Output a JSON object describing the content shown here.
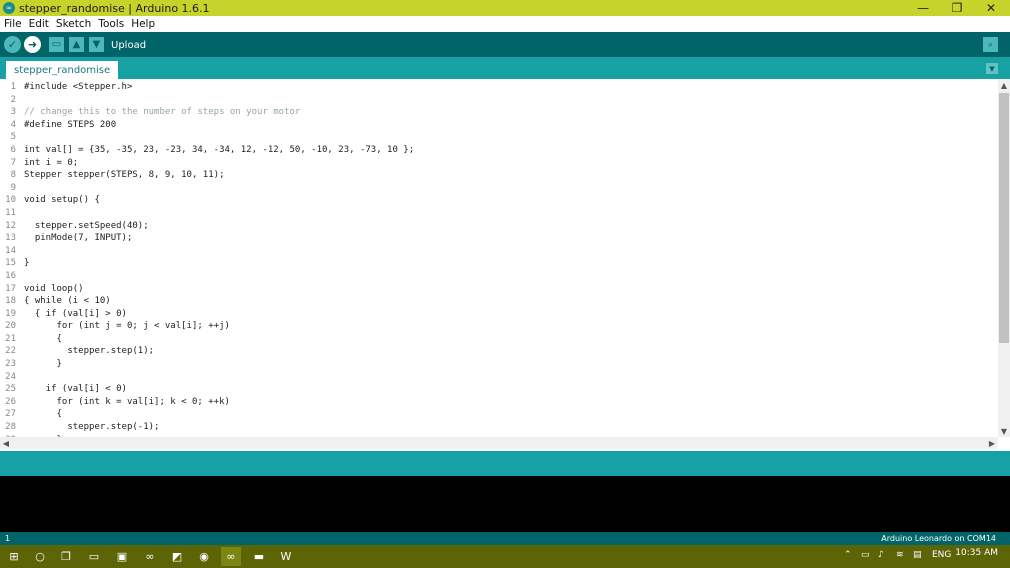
{
  "window": {
    "title": "stepper_randomise | Arduino 1.6.1",
    "app_icon": "arduino-logo-icon",
    "minimize": "—",
    "restore": "❐",
    "close": "✕"
  },
  "menubar": {
    "items": [
      "File",
      "Edit",
      "Sketch",
      "Tools",
      "Help"
    ]
  },
  "toolbar": {
    "hover_label": "Upload",
    "buttons": [
      {
        "name": "verify",
        "icon": "check-icon"
      },
      {
        "name": "upload",
        "icon": "arrow-right-icon"
      },
      {
        "name": "new",
        "icon": "new-file-icon"
      },
      {
        "name": "open",
        "icon": "open-arrow-up-icon"
      },
      {
        "name": "save",
        "icon": "save-arrow-down-icon"
      }
    ],
    "serial_monitor_icon": "magnifier-icon"
  },
  "tabs": {
    "active": "stepper_randomise",
    "menu_icon": "dropdown-triangle-icon"
  },
  "editor": {
    "lines": [
      {
        "n": "1",
        "text": "#include <Stepper.h>"
      },
      {
        "n": "2",
        "text": ""
      },
      {
        "n": "3",
        "text": "// change this to the number of steps on your motor"
      },
      {
        "n": "4",
        "text": "#define STEPS 200"
      },
      {
        "n": "5",
        "text": ""
      },
      {
        "n": "6",
        "text": "int val[] = {35, -35, 23, -23, 34, -34, 12, -12, 50, -10, 23, -73, 10 };"
      },
      {
        "n": "7",
        "text": "int i = 0;"
      },
      {
        "n": "8",
        "text": "Stepper stepper(STEPS, 8, 9, 10, 11);"
      },
      {
        "n": "9",
        "text": ""
      },
      {
        "n": "10",
        "text": "void setup() {"
      },
      {
        "n": "11",
        "text": ""
      },
      {
        "n": "12",
        "text": "  stepper.setSpeed(40);"
      },
      {
        "n": "13",
        "text": "  pinMode(7, INPUT);"
      },
      {
        "n": "14",
        "text": ""
      },
      {
        "n": "15",
        "text": "}"
      },
      {
        "n": "16",
        "text": ""
      },
      {
        "n": "17",
        "text": "void loop()"
      },
      {
        "n": "18",
        "text": "{ while (i < 10)"
      },
      {
        "n": "19",
        "text": "  { if (val[i] > 0)"
      },
      {
        "n": "20",
        "text": "      for (int j = 0; j < val[i]; ++j)"
      },
      {
        "n": "21",
        "text": "      {"
      },
      {
        "n": "22",
        "text": "        stepper.step(1);"
      },
      {
        "n": "23",
        "text": "      }"
      },
      {
        "n": "24",
        "text": ""
      },
      {
        "n": "25",
        "text": "    if (val[i] < 0)"
      },
      {
        "n": "26",
        "text": "      for (int k = val[i]; k < 0; ++k)"
      },
      {
        "n": "27",
        "text": "      {"
      },
      {
        "n": "28",
        "text": "        stepper.step(-1);"
      },
      {
        "n": "29",
        "text": "      }"
      }
    ]
  },
  "status": {
    "line_number": "1",
    "board": "Arduino Leonardo on COM14"
  },
  "taskbar": {
    "language": "ENG",
    "time": "10:35 AM"
  }
}
